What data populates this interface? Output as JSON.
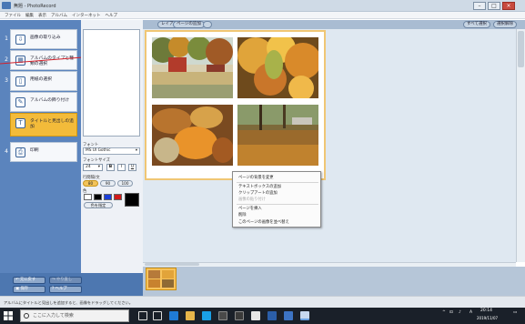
{
  "app": {
    "title": "無題 - PhotoRecord",
    "menu": [
      "ファイル",
      "編集",
      "表示",
      "アルバム",
      "インターネット",
      "ヘルプ"
    ]
  },
  "toolbar": {
    "layout_label": "レイアウト",
    "add_page_label": "ページの追加",
    "right_buttons": [
      "すべて選択",
      "選択解除"
    ]
  },
  "steps": [
    {
      "num": "1",
      "label": "画像の取り込み"
    },
    {
      "num": "2",
      "label": "アルバムのタイプと種類の選択"
    },
    {
      "num": "3",
      "label": "用紙の選択"
    },
    {
      "num": "",
      "label": "アルバムの飾り付け"
    },
    {
      "num": "",
      "label": "タイトルと見出しの追加"
    },
    {
      "num": "4",
      "label": "印刷"
    }
  ],
  "panel": {
    "font_label": "フォント",
    "font_value": "MS UI Gothic",
    "size_label": "フォントサイズ",
    "size_value": "24",
    "style_buttons": [
      "B",
      "I",
      "U"
    ],
    "layout_label": "行間隔/文",
    "layout_options": [
      "80",
      "90",
      "100"
    ],
    "color_label": "色",
    "custom_label": "色を指定"
  },
  "colors": {
    "swatches": [
      "#ffffff",
      "#000000",
      "#1b3fd9",
      "#d21a1a"
    ],
    "accent": "#f3bb3a",
    "sidebar": "#5b84bd"
  },
  "context_menu": {
    "items": [
      {
        "label": "ページの背景を変更",
        "disabled": false
      },
      {
        "label": "テキストボックスの追加",
        "disabled": false
      },
      {
        "label": "クリップアートの追加",
        "disabled": false
      },
      {
        "label": "画像の貼り付け",
        "disabled": true
      },
      {
        "label": "ページを挿入",
        "disabled": false
      },
      {
        "label": "削除",
        "disabled": false
      },
      {
        "label": "このページの画像を並べ替え",
        "disabled": false
      }
    ]
  },
  "bottom": {
    "undo_label": "元に戻す",
    "redo_label": "やり直し",
    "save_label": "保存",
    "help_label": "ヘルプ"
  },
  "status": {
    "text": "アルバムにタイトルと見出しを追加すると、画像をドラッグしてください。"
  },
  "taskbar": {
    "search_placeholder": "ここに入力して検索",
    "time": "20:14",
    "date": "2019/11/07",
    "ime": "A"
  }
}
